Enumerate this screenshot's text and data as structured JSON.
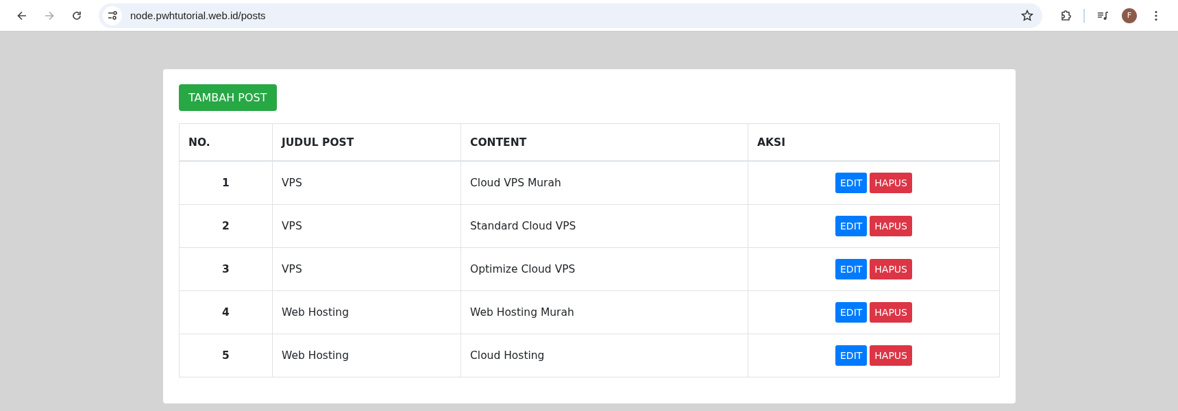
{
  "browser": {
    "url": "node.pwhtutorial.web.id/posts",
    "avatar_letter": "F"
  },
  "add_button": "TAMBAH POST",
  "table": {
    "columns": [
      "NO.",
      "JUDUL POST",
      "CONTENT",
      "AKSI"
    ],
    "rows": [
      {
        "no": "1",
        "title": "VPS",
        "content": "Cloud VPS Murah",
        "edit": "EDIT",
        "delete": "HAPUS"
      },
      {
        "no": "2",
        "title": "VPS",
        "content": "Standard Cloud VPS",
        "edit": "EDIT",
        "delete": "HAPUS"
      },
      {
        "no": "3",
        "title": "VPS",
        "content": "Optimize Cloud VPS",
        "edit": "EDIT",
        "delete": "HAPUS"
      },
      {
        "no": "4",
        "title": "Web Hosting",
        "content": "Web Hosting Murah",
        "edit": "EDIT",
        "delete": "HAPUS"
      },
      {
        "no": "5",
        "title": "Web Hosting",
        "content": "Cloud Hosting",
        "edit": "EDIT",
        "delete": "HAPUS"
      }
    ]
  }
}
